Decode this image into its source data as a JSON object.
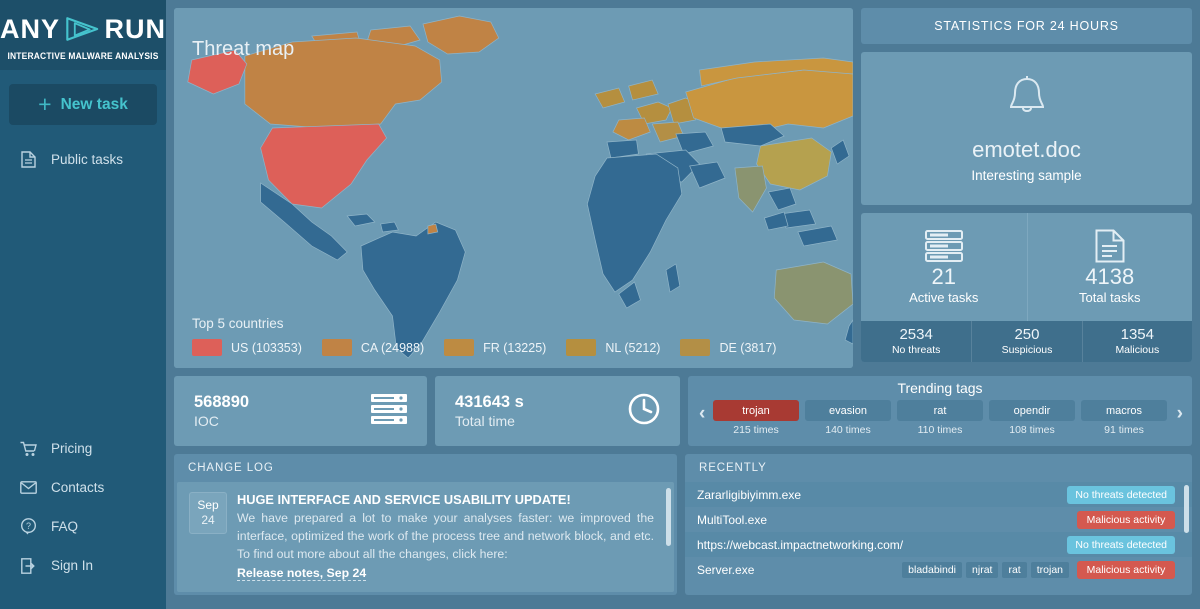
{
  "sidebar": {
    "logo": {
      "word1": "ANY",
      "word2": "RUN",
      "tagline": "INTERACTIVE MALWARE ANALYSIS",
      "mark_icon": "play-triangle-icon"
    },
    "new_task": {
      "label": "New task",
      "icon": "plus-icon"
    },
    "top_items": [
      {
        "label": "Public tasks",
        "icon": "document-icon"
      }
    ],
    "bottom_items": [
      {
        "label": "Pricing",
        "icon": "cart-icon"
      },
      {
        "label": "Contacts",
        "icon": "envelope-icon"
      },
      {
        "label": "FAQ",
        "icon": "question-bubble-icon"
      },
      {
        "label": "Sign In",
        "icon": "sign-in-icon"
      }
    ]
  },
  "map": {
    "title": "Threat map",
    "legend_title": "Top 5 countries",
    "legend": [
      {
        "code": "US",
        "count": 103353,
        "label": "US (103353)",
        "color": "#dd6059"
      },
      {
        "code": "CA",
        "count": 24988,
        "label": "CA (24988)",
        "color": "#c08345"
      },
      {
        "code": "FR",
        "count": 13225,
        "label": "FR (13225)",
        "color": "#bd8b42"
      },
      {
        "code": "NL",
        "count": 5212,
        "label": "NL (5212)",
        "color": "#b58f3f"
      },
      {
        "code": "DE",
        "count": 3817,
        "label": "DE (3817)",
        "color": "#b38f46"
      }
    ],
    "ocean_color": "#6d9bb4",
    "land_color": "#336a92"
  },
  "stats": {
    "header": "STATISTICS FOR 24 HOURS",
    "sample": {
      "icon": "bell-icon",
      "name": "emotet.doc",
      "subtitle": "Interesting sample"
    },
    "tasks": [
      {
        "icon": "server-icon",
        "value": "21",
        "label": "Active tasks"
      },
      {
        "icon": "document-icon",
        "value": "4138",
        "label": "Total tasks"
      }
    ],
    "verdicts": [
      {
        "value": "2534",
        "label": "No threats"
      },
      {
        "value": "250",
        "label": "Suspicious"
      },
      {
        "value": "1354",
        "label": "Malicious"
      }
    ]
  },
  "kpis": [
    {
      "value": "568890",
      "label": "IOC",
      "icon": "server-icon"
    },
    {
      "value": "431643 s",
      "label": "Total time",
      "icon": "clock-icon"
    }
  ],
  "trending": {
    "title": "Trending tags",
    "prev_icon": "chevron-left-icon",
    "next_icon": "chevron-right-icon",
    "tags": [
      {
        "name": "trojan",
        "times": "215 times",
        "highlighted": true
      },
      {
        "name": "evasion",
        "times": "140 times",
        "highlighted": false
      },
      {
        "name": "rat",
        "times": "110 times",
        "highlighted": false
      },
      {
        "name": "opendir",
        "times": "108 times",
        "highlighted": false
      },
      {
        "name": "macros",
        "times": "91 times",
        "highlighted": false
      }
    ]
  },
  "changelog": {
    "header": "CHANGE LOG",
    "entry": {
      "month": "Sep",
      "day": "24",
      "title": "HUGE INTERFACE AND SERVICE USABILITY UPDATE!",
      "body": "We have prepared a lot to make your analyses faster: we improved the interface, optimized the work of the process tree and network block, and etc. To find out more about all the changes, click here:",
      "link": "Release notes, Sep 24"
    }
  },
  "recently": {
    "header": "RECENTLY",
    "rows": [
      {
        "name": "Zararligibiyimm.exe",
        "tags": [],
        "verdict": "No threats detected",
        "verdict_type": "clean"
      },
      {
        "name": "MultiTool.exe",
        "tags": [],
        "verdict": "Malicious activity",
        "verdict_type": "malicious"
      },
      {
        "name": "https://webcast.impactnetworking.com/",
        "tags": [],
        "verdict": "No threats detected",
        "verdict_type": "clean"
      },
      {
        "name": "Server.exe",
        "tags": [
          "bladabindi",
          "njrat",
          "rat",
          "trojan"
        ],
        "verdict": "Malicious activity",
        "verdict_type": "malicious"
      }
    ]
  },
  "colors": {
    "sidebar_bg": "#215a78",
    "page_bg": "#4d7a96",
    "card_bg": "#6d9bb4",
    "panel_bg": "#5e8daa",
    "accent": "#45c3cd",
    "danger": "#d4594f",
    "clean": "#6ac3de",
    "hot_tag": "#a83a33"
  }
}
